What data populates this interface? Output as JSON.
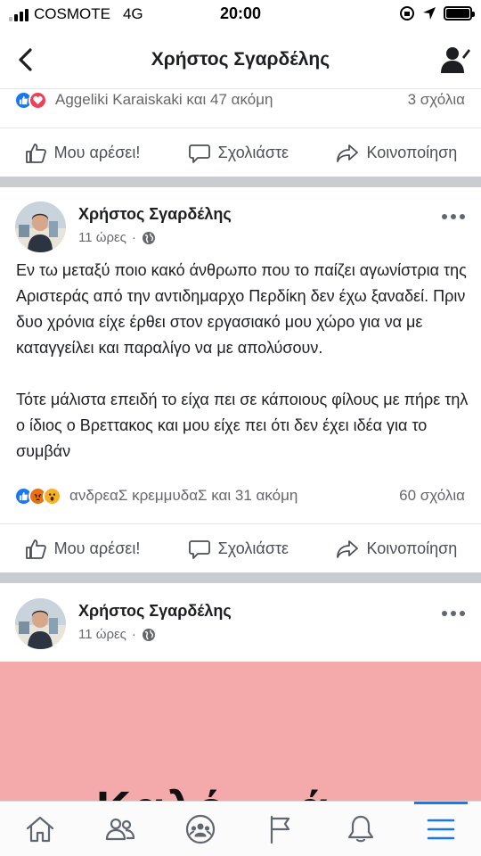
{
  "status_bar": {
    "carrier": "COSMOTE",
    "network": "4G",
    "time": "20:00"
  },
  "header": {
    "title": "Χρήστος Σγαρδέλης",
    "icons": {
      "back": "chevron-left-icon",
      "profile": "profile-edit-icon"
    }
  },
  "top_post": {
    "reactions_text": "Aggeliki Karaiskaki και 47 ακόμη",
    "reaction_icons": [
      "like-icon",
      "love-icon"
    ],
    "comments": "3 σχόλια"
  },
  "actions": {
    "like": "Μου αρέσει!",
    "comment": "Σχολιάστε",
    "share": "Κοινοποίηση"
  },
  "post1": {
    "author": "Χρήστος Σγαρδέλης",
    "time": "11 ώρες",
    "paragraphs": [
      "Εν τω μεταξύ ποιο κακό άνθρωπο που το παίζει αγωνίστρια της Αριστεράς από την αντιδημαρχο Περδίκη δεν έχω ξαναδεί. Πριν δυο χρόνια είχε έρθει στον εργασιακό μου χώρο για να με καταγγείλει και παραλίγο να με απολύσουν.",
      "Τότε μάλιστα επειδή το είχα πει σε κάποιους φίλους με πήρε τηλ ο ίδιος ο Βρεττακος και μου είχε πει ότι δεν έχει ιδέα για το συμβάν"
    ],
    "reactions_text": "ανδρεαΣ κρεμμυδαΣ και 31 ακόμη",
    "reaction_icons": [
      "like-icon",
      "angry-icon",
      "wow-icon"
    ],
    "comments": "60 σχόλια"
  },
  "post2": {
    "author": "Χρήστος Σγαρδέλης",
    "time": "11 ώρες",
    "image_text": "Καλό…  ά"
  },
  "tabbar": {
    "items": [
      "home-icon",
      "friends-icon",
      "groups-icon",
      "pages-flag-icon",
      "notifications-bell-icon",
      "menu-icon"
    ],
    "active_index": 5
  },
  "colors": {
    "accent": "#1877f2",
    "divider": "#c9ccd1",
    "image_bg": "#f4a9aa"
  }
}
